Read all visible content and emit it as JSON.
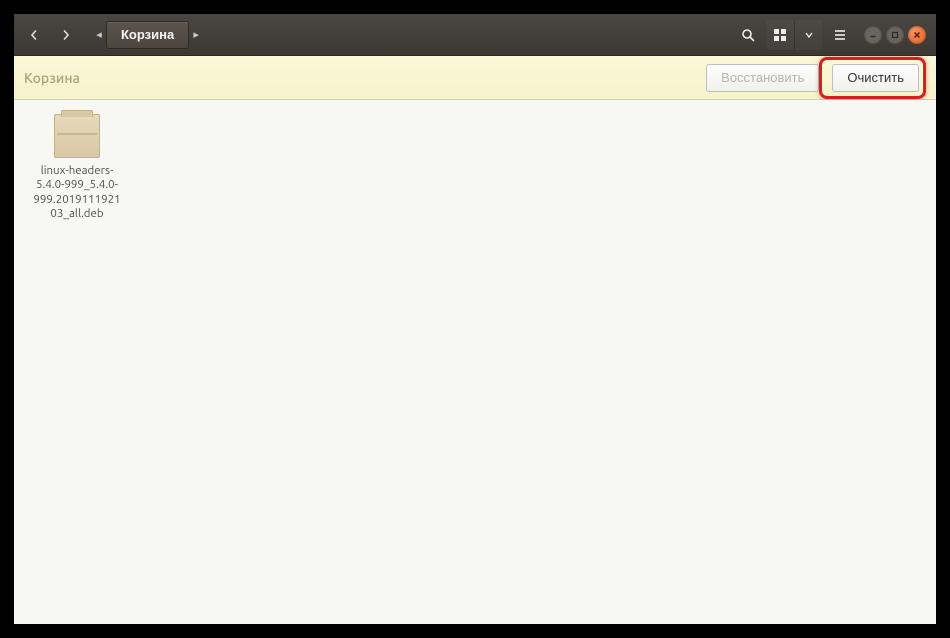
{
  "titlebar": {
    "path_label": "Корзина"
  },
  "actionbar": {
    "title": "Корзина",
    "restore_label": "Восстановить",
    "empty_label": "Очистить"
  },
  "files": [
    {
      "name": "linux-headers-5.4.0-999_5.4.0-999.201911192103_all.deb"
    }
  ]
}
